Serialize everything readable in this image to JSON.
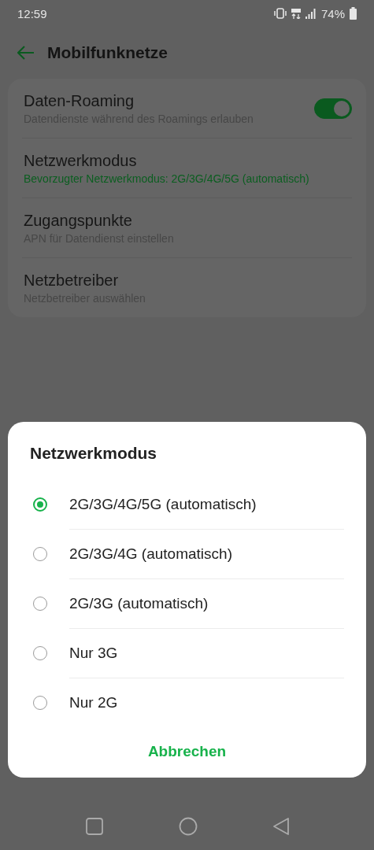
{
  "status_bar": {
    "time": "12:59",
    "battery": "74%"
  },
  "header": {
    "title": "Mobilfunknetze"
  },
  "settings": [
    {
      "kind": "toggle",
      "title": "Daten-Roaming",
      "subtitle": "Datendienste während des Roamings erlauben",
      "on": true
    },
    {
      "kind": "link",
      "title": "Netzwerkmodus",
      "subtitle": "Bevorzugter Netzwerkmodus: 2G/3G/4G/5G (automatisch)",
      "highlighted": true
    },
    {
      "kind": "link",
      "title": "Zugangspunkte",
      "subtitle": "APN für Datendienst einstellen",
      "highlighted": false
    },
    {
      "kind": "link",
      "title": "Netzbetreiber",
      "subtitle": "Netzbetreiber auswählen",
      "highlighted": false
    }
  ],
  "dialog": {
    "title": "Netzwerkmodus",
    "options": [
      {
        "label": "2G/3G/4G/5G (automatisch)",
        "selected": true
      },
      {
        "label": "2G/3G/4G (automatisch)",
        "selected": false
      },
      {
        "label": "2G/3G (automatisch)",
        "selected": false
      },
      {
        "label": "Nur 3G",
        "selected": false
      },
      {
        "label": "Nur 2G",
        "selected": false
      }
    ],
    "cancel": "Abbrechen"
  }
}
